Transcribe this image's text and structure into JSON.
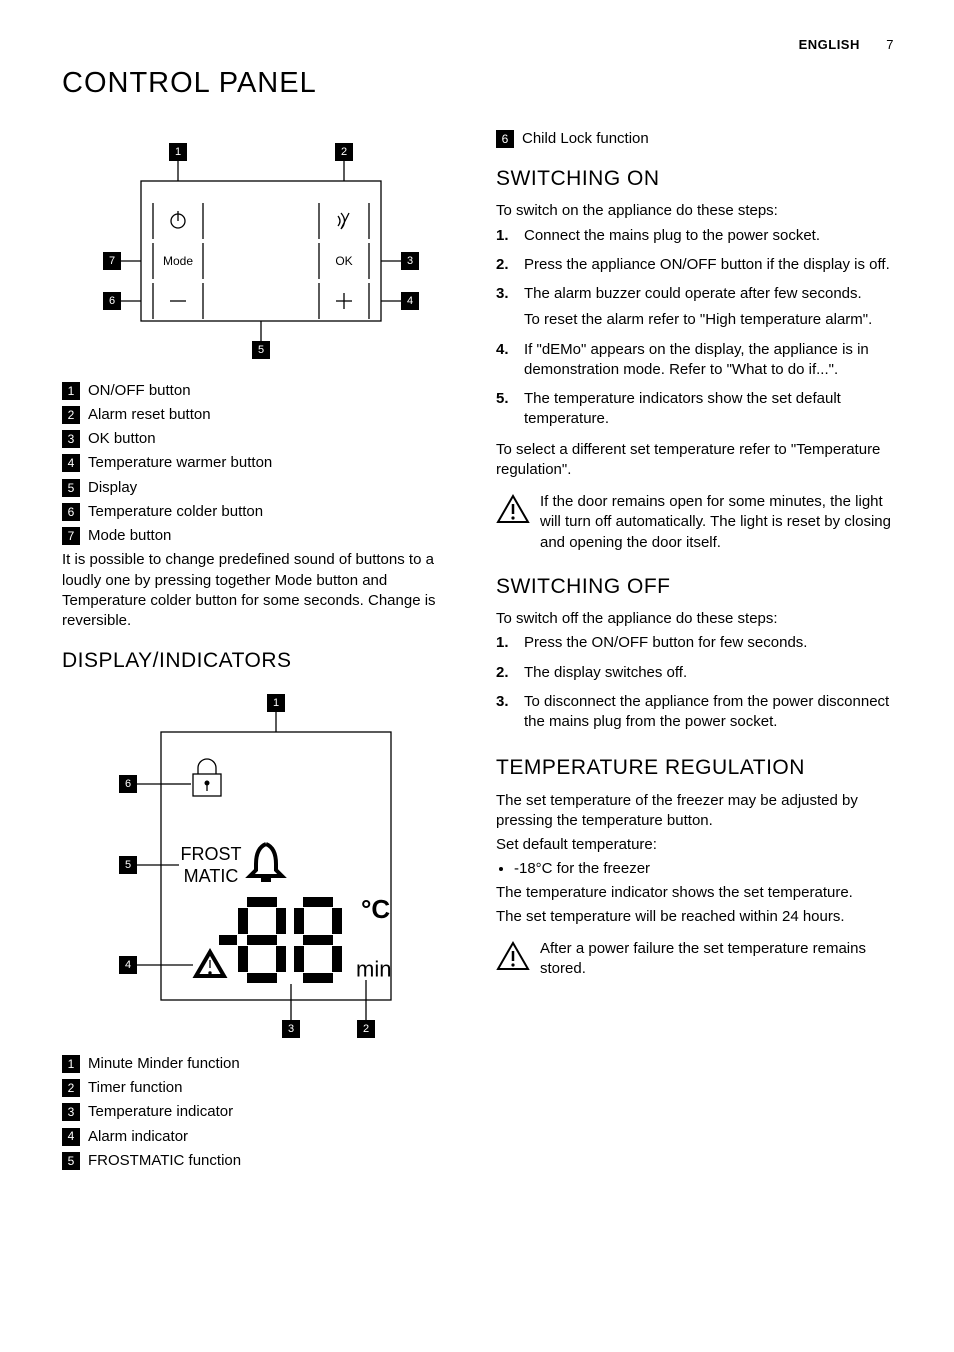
{
  "header": {
    "language": "ENGLISH",
    "page_number": "7"
  },
  "title": "CONTROL PANEL",
  "panel_diagram": {
    "callouts": [
      "1",
      "2",
      "3",
      "4",
      "5",
      "6",
      "7"
    ],
    "buttons": {
      "mode": "Mode",
      "ok": "OK"
    }
  },
  "panel_legend": [
    {
      "n": "1",
      "label": "ON/OFF button"
    },
    {
      "n": "2",
      "label": "Alarm reset button"
    },
    {
      "n": "3",
      "label": "OK button"
    },
    {
      "n": "4",
      "label": "Temperature warmer button"
    },
    {
      "n": "5",
      "label": "Display"
    },
    {
      "n": "6",
      "label": "Temperature colder button"
    },
    {
      "n": "7",
      "label": "Mode button"
    }
  ],
  "panel_note": "It is possible to change predefined sound of buttons to a loudly one by pressing together Mode button and Temperature colder button for some seconds. Change is reversible.",
  "display_heading": "DISPLAY/INDICATORS",
  "display_diagram": {
    "callouts": [
      "1",
      "2",
      "3",
      "4",
      "5",
      "6"
    ],
    "labels": {
      "frost1": "FROST",
      "frost2": "MATIC",
      "deg": "°C",
      "min": "min"
    }
  },
  "display_legend": [
    {
      "n": "1",
      "label": "Minute Minder function"
    },
    {
      "n": "2",
      "label": "Timer function"
    },
    {
      "n": "3",
      "label": "Temperature indicator"
    },
    {
      "n": "4",
      "label": "Alarm indicator"
    },
    {
      "n": "5",
      "label": "FROSTMATIC function"
    }
  ],
  "right_top_legend": {
    "n": "6",
    "label": "Child Lock function"
  },
  "switching_on": {
    "heading": "SWITCHING ON",
    "intro": "To switch on the appliance do these steps:",
    "steps": [
      [
        "Connect the mains plug to the power socket."
      ],
      [
        "Press the appliance ON/OFF button if the display is off."
      ],
      [
        "The alarm buzzer could operate after few seconds.",
        "To reset the alarm refer to \"High temperature alarm\"."
      ],
      [
        "If \"dEMo\" appears on the display, the appliance is in demonstration mode. Refer to \"What to do if...\"."
      ],
      [
        "The temperature indicators show the set default temperature."
      ]
    ],
    "outro": "To select a different set temperature refer to \"Temperature regulation\".",
    "warning": "If the door remains open for some minutes, the light will turn off automatically. The light is reset by closing and opening the door itself."
  },
  "switching_off": {
    "heading": "SWITCHING OFF",
    "intro": "To switch off the appliance do these steps:",
    "steps": [
      [
        "Press the ON/OFF button for few seconds."
      ],
      [
        "The display switches off."
      ],
      [
        "To disconnect the appliance from the power disconnect the mains plug from the power socket."
      ]
    ]
  },
  "temp_reg": {
    "heading": "TEMPERATURE REGULATION",
    "p1": "The set temperature of the freezer may be adjusted by pressing the temperature button.",
    "p2": "Set default temperature:",
    "bullet": "-18°C for the freezer",
    "p3": "The temperature indicator shows the set temperature.",
    "p4": "The set temperature will be reached within 24 hours.",
    "warning": "After a power failure the set temperature remains stored."
  }
}
